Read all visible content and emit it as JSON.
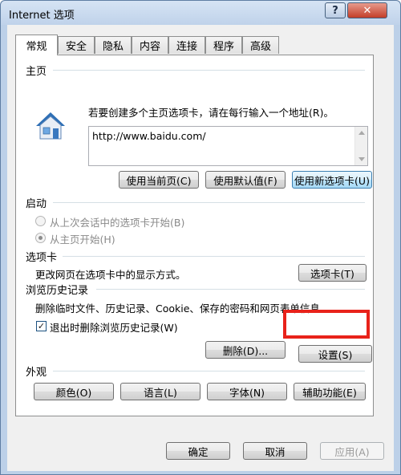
{
  "window": {
    "title": "Internet 选项",
    "help_label": "?",
    "close_label": "✕"
  },
  "tabs": [
    {
      "label": "常规",
      "active": true
    },
    {
      "label": "安全"
    },
    {
      "label": "隐私"
    },
    {
      "label": "内容"
    },
    {
      "label": "连接"
    },
    {
      "label": "程序"
    },
    {
      "label": "高级"
    }
  ],
  "homepage": {
    "group_label": "主页",
    "instructions": "若要创建多个主页选项卡，请在每行输入一个地址(R)。",
    "url": "http://www.baidu.com/",
    "btn_current": "使用当前页(C)",
    "btn_default": "使用默认值(F)",
    "btn_newtab": "使用新选项卡(U)"
  },
  "startup": {
    "group_label": "启动",
    "option_last_session": "从上次会话中的选项卡开始(B)",
    "option_homepage": "从主页开始(H)"
  },
  "tabs_section": {
    "group_label": "选项卡",
    "description": "更改网页在选项卡中的显示方式。",
    "btn_tabs": "选项卡(T)"
  },
  "history": {
    "group_label": "浏览历史记录",
    "description": "删除临时文件、历史记录、Cookie、保存的密码和网页表单信息。",
    "checkbox_label": "退出时删除浏览历史记录(W)",
    "checkbox_checked": true,
    "btn_delete": "删除(D)...",
    "btn_settings": "设置(S)"
  },
  "appearance": {
    "group_label": "外观",
    "btn_colors": "颜色(O)",
    "btn_languages": "语言(L)",
    "btn_fonts": "字体(N)",
    "btn_accessibility": "辅助功能(E)"
  },
  "footer": {
    "btn_ok": "确定",
    "btn_cancel": "取消",
    "btn_apply": "应用(A)"
  },
  "colors": {
    "highlight": "#e8221a",
    "title_bg": "#bcd0e8",
    "close_red": "#c33e28"
  }
}
